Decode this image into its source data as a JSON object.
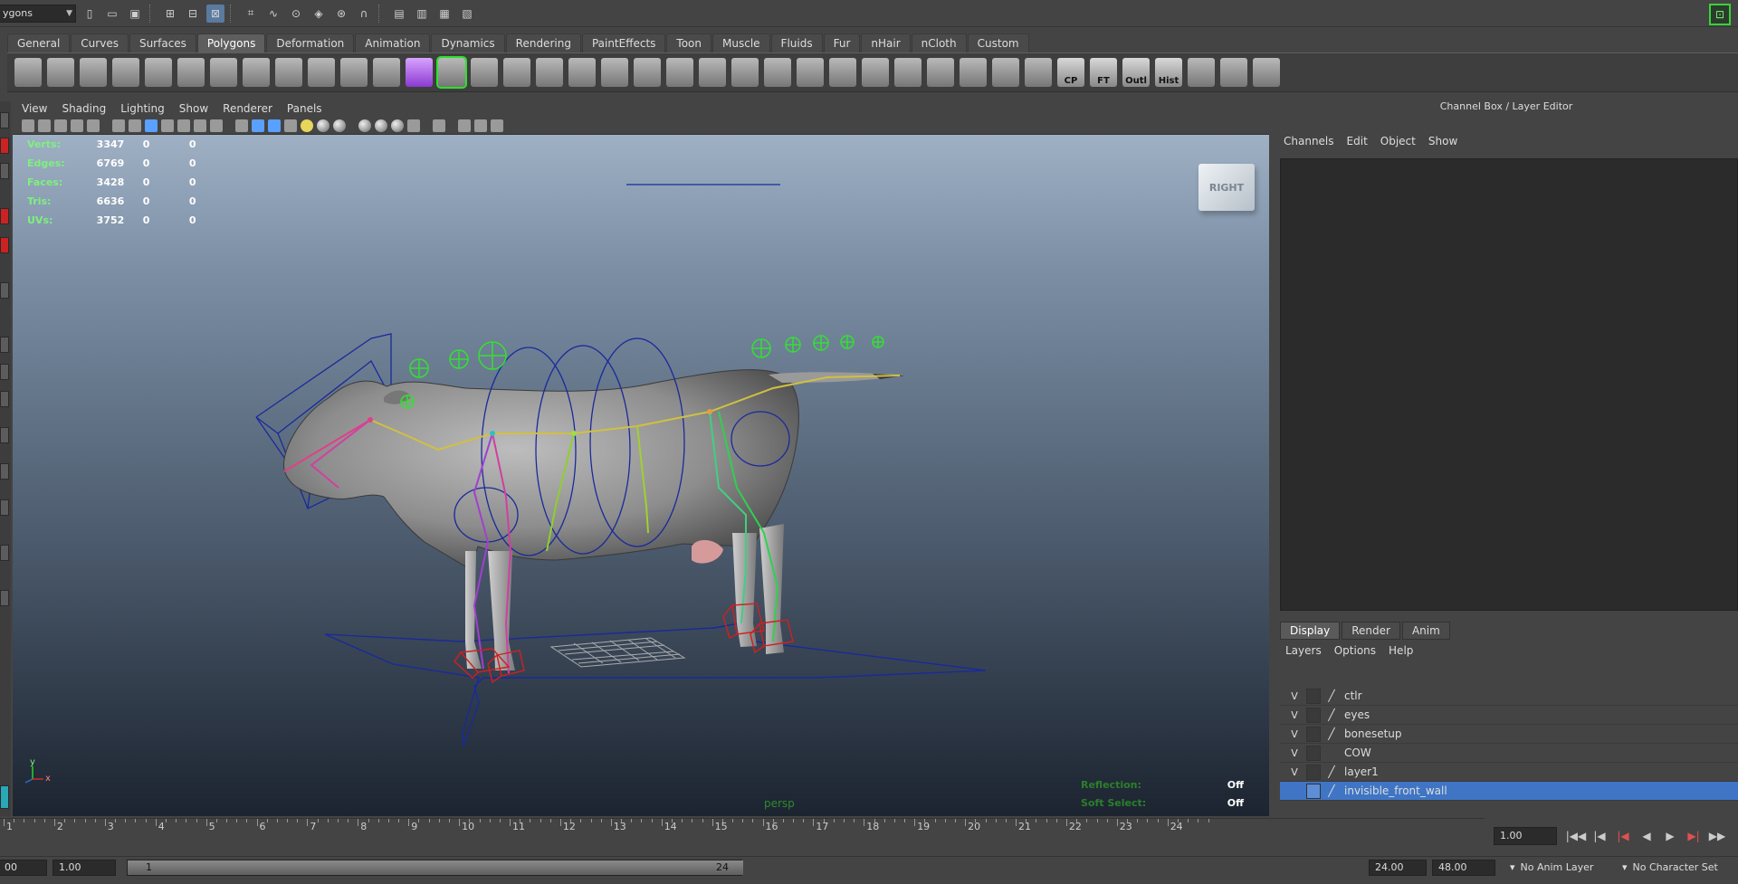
{
  "statusline": {
    "mode": "ygons"
  },
  "shelf": {
    "tabs": [
      "General",
      "Curves",
      "Surfaces",
      "Polygons",
      "Deformation",
      "Animation",
      "Dynamics",
      "Rendering",
      "PaintEffects",
      "Toon",
      "Muscle",
      "Fluids",
      "Fur",
      "nHair",
      "nCloth",
      "Custom"
    ],
    "active_tab": "Polygons",
    "text_icons": [
      "CP",
      "FT",
      "Outl",
      "Hist"
    ]
  },
  "viewport": {
    "menus": [
      "View",
      "Shading",
      "Lighting",
      "Show",
      "Renderer",
      "Panels"
    ],
    "hud": [
      {
        "label": "Verts:",
        "v1": "3347",
        "v2": "0",
        "v3": "0"
      },
      {
        "label": "Edges:",
        "v1": "6769",
        "v2": "0",
        "v3": "0"
      },
      {
        "label": "Faces:",
        "v1": "3428",
        "v2": "0",
        "v3": "0"
      },
      {
        "label": "Tris:",
        "v1": "6636",
        "v2": "0",
        "v3": "0"
      },
      {
        "label": "UVs:",
        "v1": "3752",
        "v2": "0",
        "v3": "0"
      }
    ],
    "viewcube_label": "RIGHT",
    "camera": "persp",
    "reflection_label": "Reflection:",
    "reflection_value": "Off",
    "softselect_label": "Soft Select:",
    "softselect_value": "Off",
    "axis_y": "y",
    "axis_x": "x"
  },
  "right_panel": {
    "title": "Channel Box / Layer Editor",
    "menus": [
      "Channels",
      "Edit",
      "Object",
      "Show"
    ],
    "tabs": [
      "Display",
      "Render",
      "Anim"
    ],
    "active_tab": "Display",
    "layer_menus": [
      "Layers",
      "Options",
      "Help"
    ],
    "layers": [
      {
        "v": "V",
        "name": "ctlr"
      },
      {
        "v": "V",
        "name": "eyes"
      },
      {
        "v": "V",
        "name": "bonesetup"
      },
      {
        "v": "V",
        "name": "COW"
      },
      {
        "v": "V",
        "name": "layer1"
      },
      {
        "v": "",
        "name": "invisible_front_wall"
      }
    ]
  },
  "timeslider": {
    "ticks": [
      "1",
      "2",
      "3",
      "4",
      "5",
      "6",
      "7",
      "8",
      "9",
      "10",
      "11",
      "12",
      "13",
      "14",
      "15",
      "16",
      "17",
      "18",
      "19",
      "20",
      "21",
      "22",
      "23",
      "24"
    ],
    "current_time": "1.00"
  },
  "rangebar": {
    "start_field": "00",
    "playback_start": "1.00",
    "range_start": "1",
    "range_end": "24",
    "playback_end": "24.00",
    "end_field": "48.00",
    "anim_layer": "No Anim Layer",
    "character_set": "No Character Set"
  },
  "colors": {
    "hud_label": "#7ef07e",
    "selection": "#3f75c4",
    "joint_green": "#33e033"
  }
}
